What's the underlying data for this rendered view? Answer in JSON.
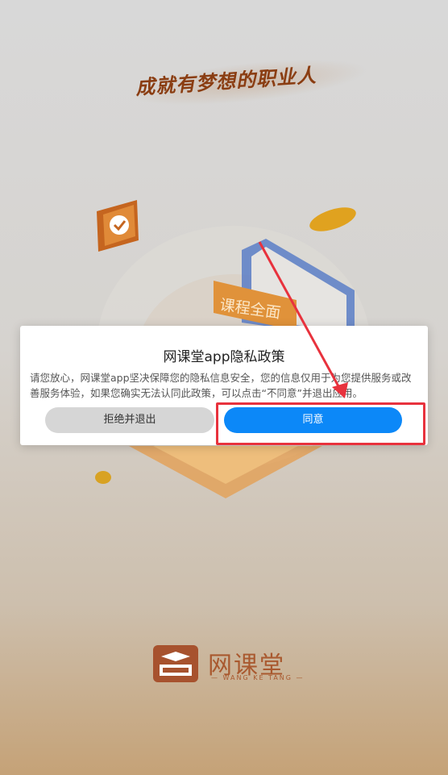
{
  "splash": {
    "slogan": "成就有梦想的职业人",
    "course_sign": "课程全面",
    "logo_name": "网课堂",
    "logo_sub": "— WANG KE TANG —"
  },
  "dialog": {
    "title": "网课堂app隐私政策",
    "body": "请您放心，网课堂app坚决保障您的隐私信息安全，您的信息仅用于为您提供服务或改善服务体验，如果您确实无法认同此政策，可以点击“不同意”并退出应用。",
    "reject_label": "拒绝并退出",
    "agree_label": "同意"
  },
  "colors": {
    "agree_button": "#0c88f8",
    "reject_button": "#d6d6d6",
    "highlight": "#e8323d",
    "brand": "#a7522e"
  }
}
